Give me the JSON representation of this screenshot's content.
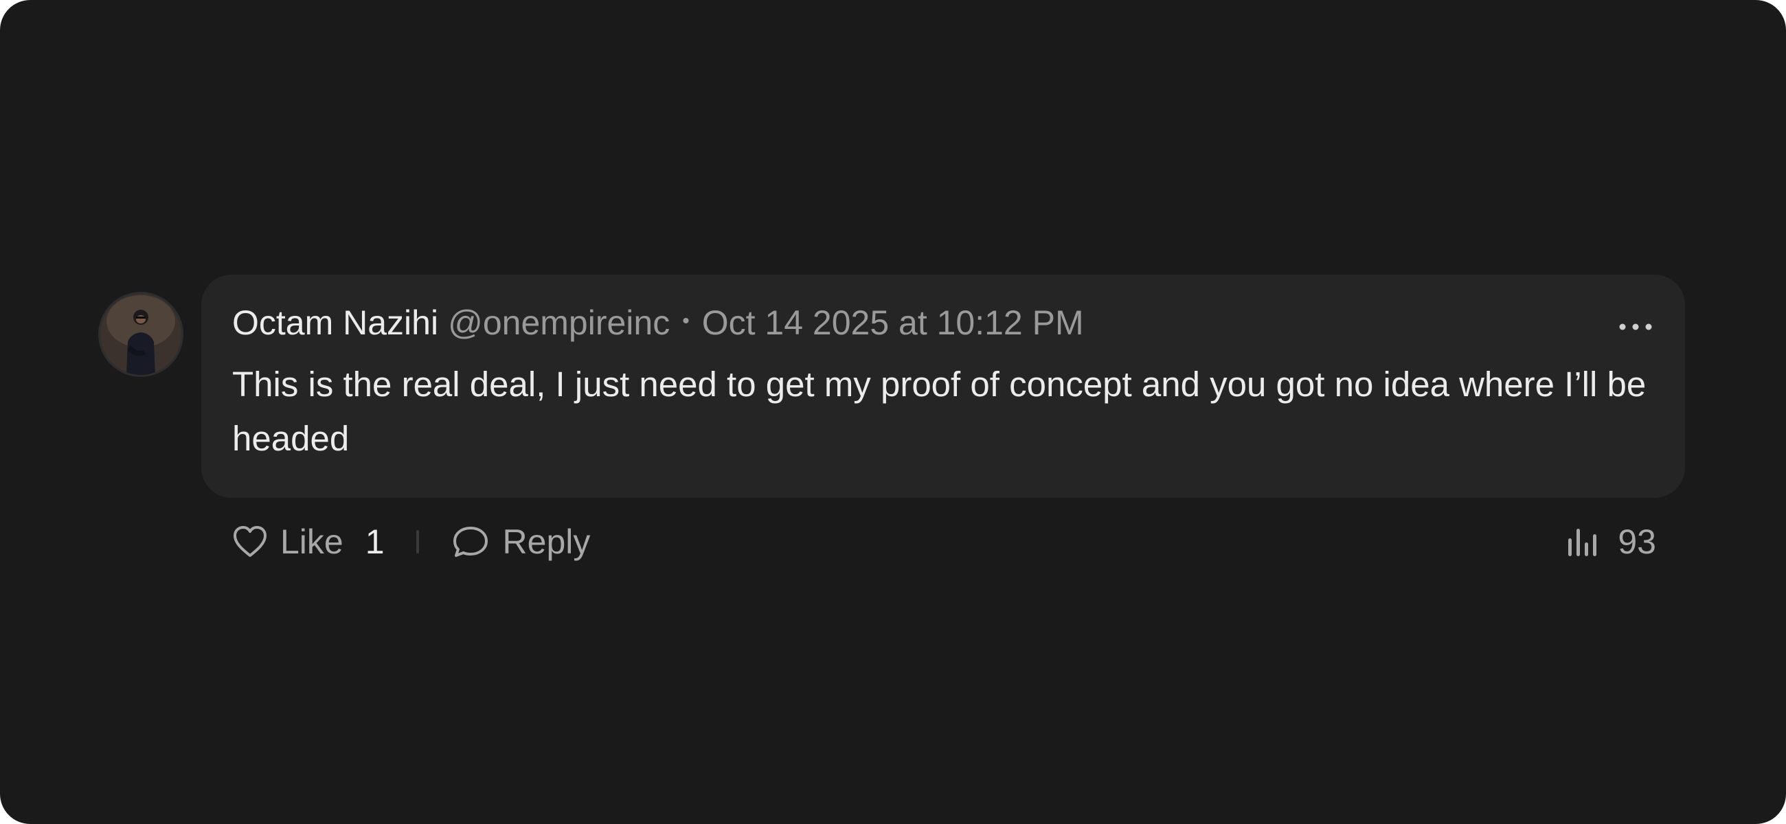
{
  "comment": {
    "author_name": "Octam Nazihi",
    "handle": "@onempireinc",
    "separator": "•",
    "timestamp": "Oct 14 2025 at 10:12 PM",
    "text": "This is the real deal, I just need to get my proof of concept and you got no idea where I’ll be headed",
    "more_icon": "ellipsis-horizontal-icon",
    "avatar_icon": "user-photo"
  },
  "actions": {
    "like_label": "Like",
    "like_count": "1",
    "like_icon": "heart-icon",
    "reply_label": "Reply",
    "reply_icon": "speech-bubble-icon",
    "views_icon": "bar-chart-icon",
    "views_count": "93"
  },
  "colors": {
    "background": "#1a1a1a",
    "bubble": "#252525",
    "primary_text": "#ececec",
    "secondary_text": "#9a9a9a"
  }
}
